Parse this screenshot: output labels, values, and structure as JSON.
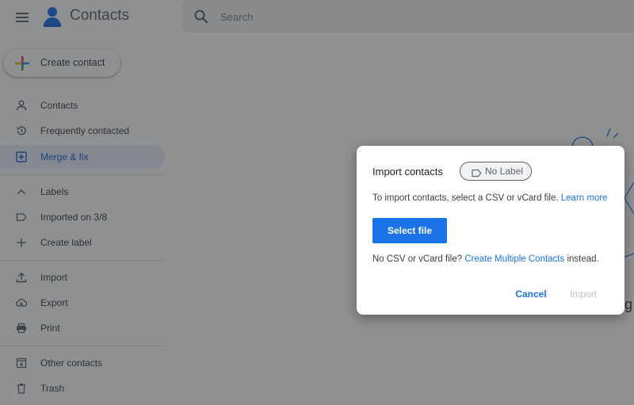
{
  "app": {
    "title": "Contacts",
    "menu_icon": "hamburger-menu-icon",
    "logo_icon": "contacts-person-icon"
  },
  "search": {
    "placeholder": "Search",
    "value": ""
  },
  "create_button": {
    "label": "Create contact",
    "icon": "multicolor-plus-icon"
  },
  "sidebar": {
    "items": [
      {
        "label": "Contacts",
        "icon": "person-icon",
        "active": false
      },
      {
        "label": "Frequently contacted",
        "icon": "history-icon",
        "active": false
      },
      {
        "label": "Merge & fix",
        "icon": "merge-fix-icon",
        "active": true
      },
      {
        "label": "Labels",
        "icon": "chevron-up-icon",
        "active": false
      },
      {
        "label": "Imported on 3/8",
        "icon": "label-icon",
        "active": false
      },
      {
        "label": "Create label",
        "icon": "plus-icon",
        "active": false
      },
      {
        "label": "Import",
        "icon": "upload-icon",
        "active": false
      },
      {
        "label": "Export",
        "icon": "cloud-download-icon",
        "active": false
      },
      {
        "label": "Print",
        "icon": "printer-icon",
        "active": false
      },
      {
        "label": "Other contacts",
        "icon": "archive-icon",
        "active": false
      },
      {
        "label": "Trash",
        "icon": "trash-icon",
        "active": false
      }
    ]
  },
  "dialog": {
    "title": "Import contacts",
    "label_chip": "No Label",
    "instruction_prefix": "To import contacts, select a CSV or vCard file.",
    "learn_more": "Learn more",
    "select_file": "Select file",
    "alt_prefix": "No CSV or vCard file?",
    "alt_link": "Create Multiple Contacts",
    "alt_suffix": "instead.",
    "cancel": "Cancel",
    "import": "Import"
  },
  "colors": {
    "accent": "#1a73e8",
    "active_bg": "#e8f0fe",
    "scrim": "rgba(32,33,36,0.5)"
  }
}
